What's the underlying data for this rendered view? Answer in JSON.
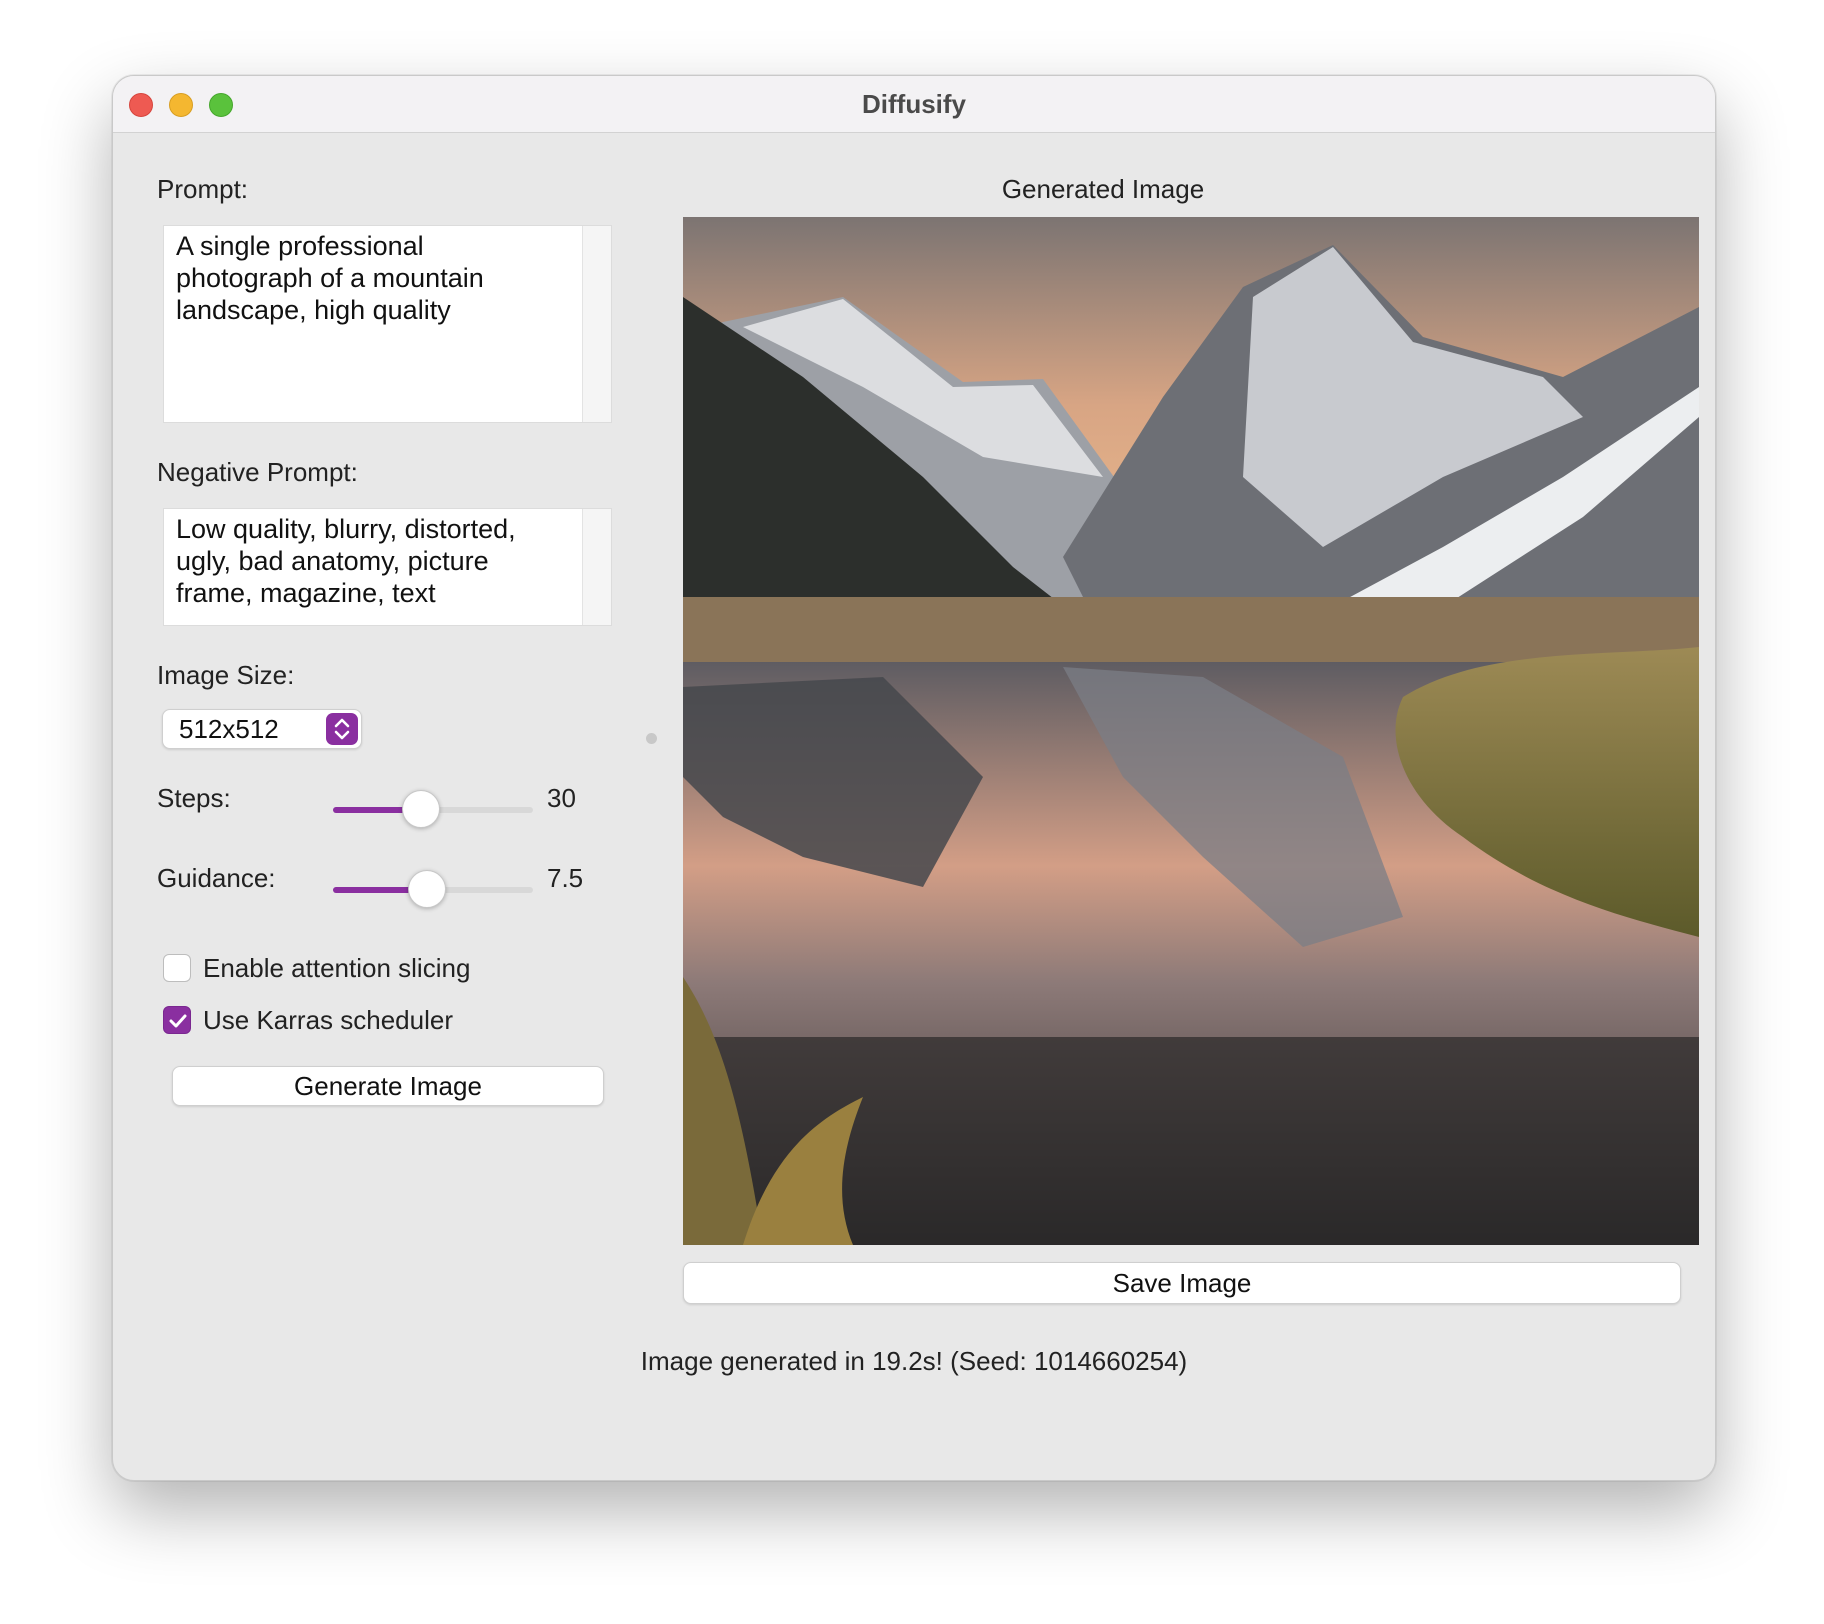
{
  "window": {
    "title": "Diffusify"
  },
  "left_panel": {
    "prompt_label": "Prompt:",
    "prompt_value": "A single professional\nphotograph of a mountain\nlandscape, high quality",
    "negative_prompt_label": "Negative Prompt:",
    "negative_prompt_value": "Low quality, blurry, distorted,\nugly, bad anatomy, picture\nframe, magazine, text",
    "image_size_label": "Image Size:",
    "image_size_value": "512x512",
    "steps_label": "Steps:",
    "steps_value": "30",
    "steps_level": 0.44,
    "guidance_label": "Guidance:",
    "guidance_value": "7.5",
    "guidance_level": 0.47,
    "attention_slicing_label": "Enable attention slicing",
    "attention_slicing_checked": false,
    "karras_label": "Use Karras scheduler",
    "karras_checked": true,
    "generate_button": "Generate Image"
  },
  "right_panel": {
    "image_title": "Generated Image",
    "save_button": "Save Image"
  },
  "status": "Image generated in 19.2s! (Seed: 1014660254)",
  "colors": {
    "accent": "#8a2fa0",
    "window_bg": "#e8e8e8"
  }
}
